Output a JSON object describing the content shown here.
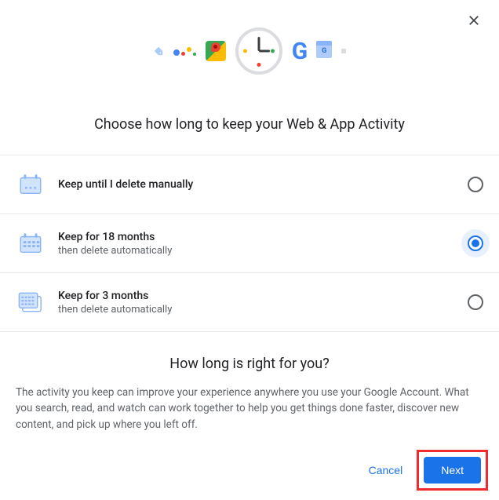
{
  "title": "Choose how long to keep your Web & App Activity",
  "options": [
    {
      "title": "Keep until I delete manually",
      "subtitle": "",
      "selected": false,
      "icon": "calendar-dots"
    },
    {
      "title": "Keep for 18 months",
      "subtitle": "then delete automatically",
      "selected": true,
      "icon": "calendar-single"
    },
    {
      "title": "Keep for 3 months",
      "subtitle": "then delete automatically",
      "selected": false,
      "icon": "calendar-stack"
    }
  ],
  "info": {
    "title": "How long is right for you?",
    "body": "The activity you keep can improve your experience anywhere you use your Google Account. What you search, read, and watch can work together to help you get things done faster, discover new content, and pick up where you left off."
  },
  "actions": {
    "cancel": "Cancel",
    "next": "Next"
  },
  "colors": {
    "primary": "#1a73e8",
    "textSecondary": "#5f6368",
    "highlight": "#ef2b2d"
  }
}
